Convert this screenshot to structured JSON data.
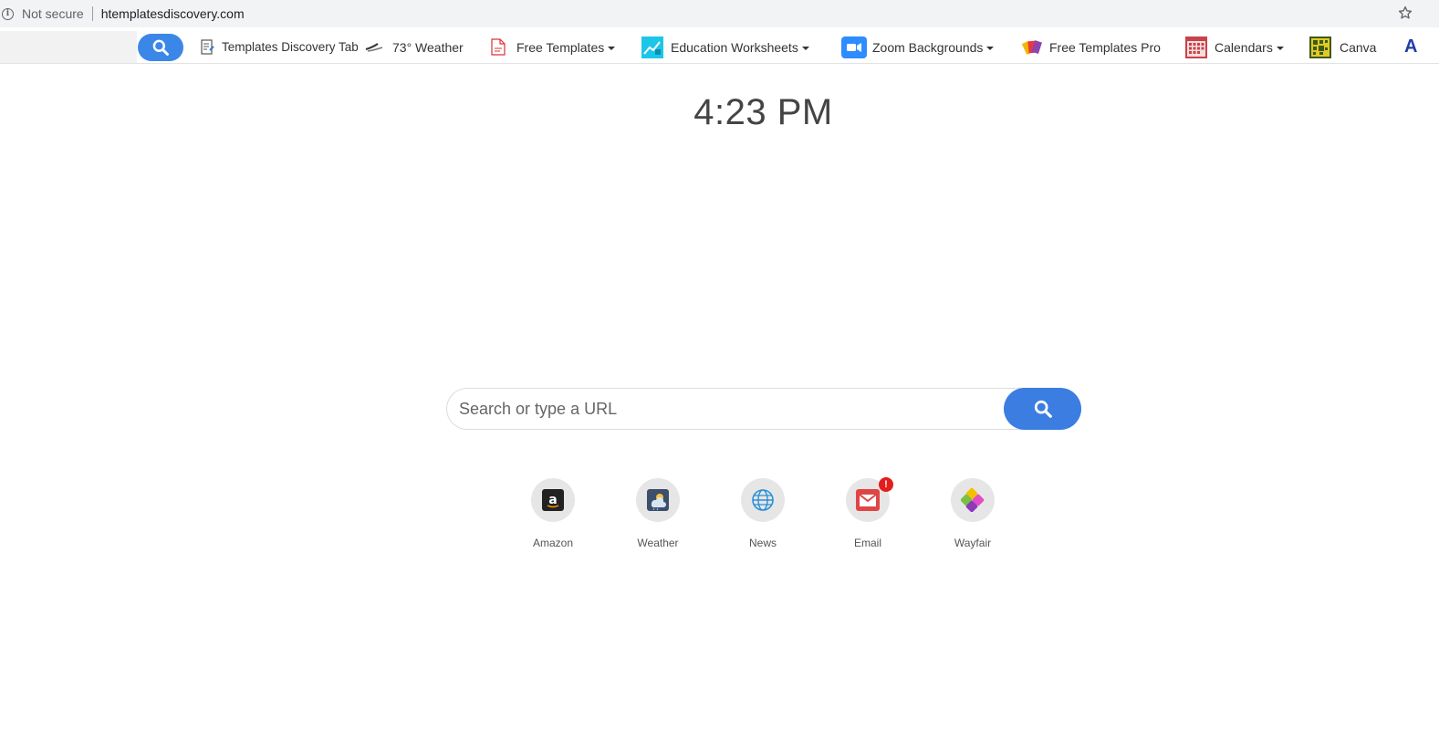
{
  "browser": {
    "security_label": "Not secure",
    "url": "htemplatesdiscovery.com"
  },
  "toolbar": {
    "items": [
      {
        "label": "Templates Discovery Tab",
        "icon": "document-edit-icon"
      },
      {
        "label": "73° Weather",
        "icon": "wind-icon"
      },
      {
        "label": "Free Templates",
        "icon": "pdf-document-icon",
        "dropdown": true
      },
      {
        "label": "Education Worksheets",
        "icon": "worksheet-chart-icon",
        "dropdown": true
      },
      {
        "label": "Zoom Backgrounds",
        "icon": "zoom-camera-icon",
        "dropdown": true
      },
      {
        "label": "Free Templates Pro",
        "icon": "color-cards-icon"
      },
      {
        "label": "Calendars",
        "icon": "calendar-icon",
        "dropdown": true
      },
      {
        "label": "Canva",
        "icon": "canva-calendar-icon"
      }
    ],
    "trailing_icon_letter": "A"
  },
  "clock": {
    "time": "4:23 PM"
  },
  "search": {
    "placeholder": "Search or type a URL"
  },
  "tiles": [
    {
      "label": "Amazon",
      "icon": "amazon-icon"
    },
    {
      "label": "Weather",
      "icon": "weather-icon"
    },
    {
      "label": "News",
      "icon": "globe-icon"
    },
    {
      "label": "Email",
      "icon": "mail-icon",
      "badge": "!"
    },
    {
      "label": "Wayfair",
      "icon": "wayfair-icon"
    }
  ],
  "colors": {
    "accent_blue": "#3b7de0",
    "badge_red": "#e41d1d"
  }
}
